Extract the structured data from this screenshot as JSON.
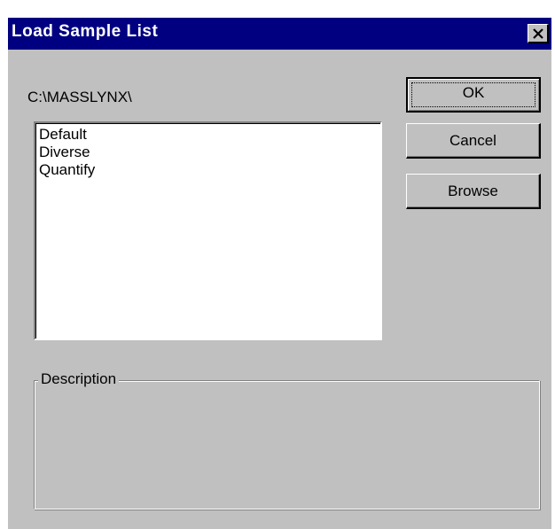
{
  "window": {
    "title": "Load Sample List",
    "close_symbol": "×"
  },
  "path": "C:\\MASSLYNX\\",
  "list": {
    "items": [
      "Default",
      "Diverse",
      "Quantify"
    ]
  },
  "buttons": {
    "ok": "OK",
    "cancel": "Cancel",
    "browse": "Browse"
  },
  "description": {
    "label": "Description",
    "text": ""
  },
  "colors": {
    "titlebar": "#000080",
    "face": "#c0c0c0",
    "list_bg": "#ffffff"
  }
}
